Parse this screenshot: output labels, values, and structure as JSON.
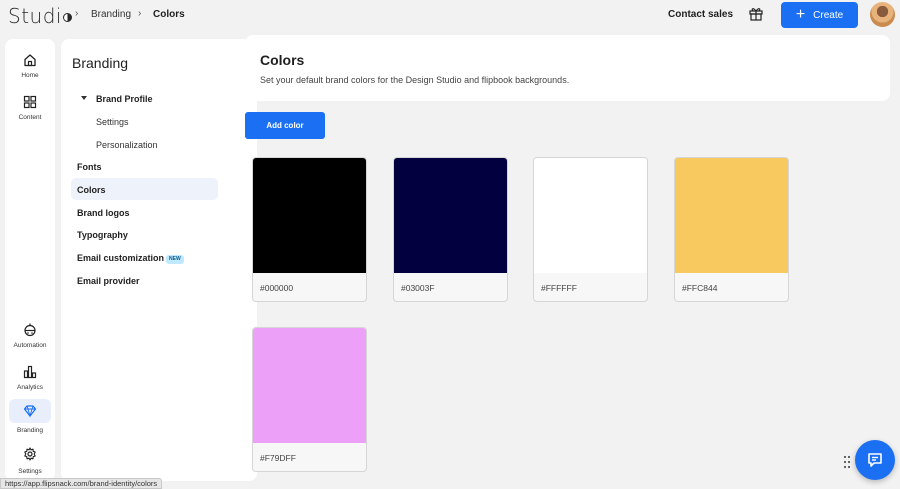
{
  "app": {
    "logo_text": "Studi"
  },
  "breadcrumb": {
    "items": [
      "Branding",
      "Colors"
    ]
  },
  "topbar": {
    "contact_label": "Contact sales",
    "create_label": "Create",
    "icons": {
      "gift": "gift-icon",
      "avatar": "user-avatar"
    },
    "accent": "#1a6ff2"
  },
  "rail": {
    "items": [
      {
        "label": "Home",
        "icon": "home-icon"
      },
      {
        "label": "Content",
        "icon": "grid-icon"
      },
      {
        "label": "Automation",
        "icon": "robot-icon"
      },
      {
        "label": "Analytics",
        "icon": "bar-chart-icon"
      },
      {
        "label": "Branding",
        "icon": "diamond-icon",
        "active": true
      },
      {
        "label": "Settings",
        "icon": "gear-icon"
      }
    ]
  },
  "subnav": {
    "title": "Branding",
    "brand_profile": "Brand Profile",
    "settings": "Settings",
    "personalization": "Personalization",
    "fonts": "Fonts",
    "colors": "Colors",
    "brand_logos": "Brand logos",
    "typography": "Typography",
    "email_customization": "Email customization",
    "new_badge": "NEW",
    "email_provider": "Email provider",
    "active_item": "Colors"
  },
  "main": {
    "title": "Colors",
    "description": "Set your default brand colors for the Design Studio and flipbook backgrounds.",
    "add_color_label": "Add color",
    "colors": [
      {
        "hex": "#000000",
        "value": "#000000"
      },
      {
        "hex": "#03003F",
        "value": "#03003F"
      },
      {
        "hex": "#FFFFFF",
        "value": "#FFFFFF"
      },
      {
        "hex": "#FFC844",
        "value": "#F8C95F"
      },
      {
        "hex": "#F79DFF",
        "value": "#EDA0F7"
      }
    ]
  },
  "status_url": "https://app.flipsnack.com/brand-identity/colors",
  "chat": {
    "icon": "chat-icon",
    "grip_icon": "drag-handle-icon"
  }
}
